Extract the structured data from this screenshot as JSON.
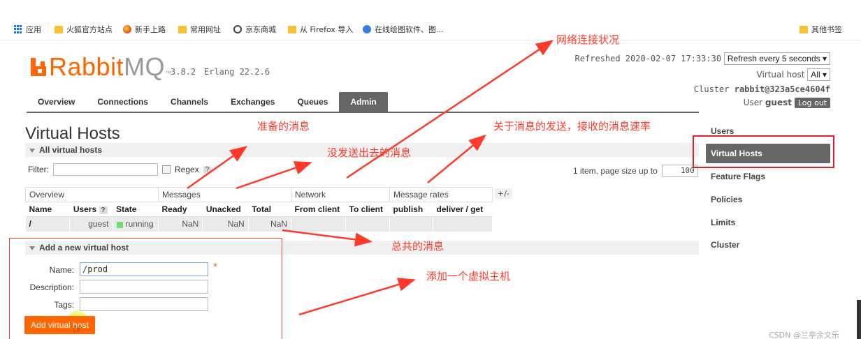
{
  "bookmarks": [
    {
      "label": "应用",
      "icon": "apps-grid-icon"
    },
    {
      "label": "火狐官方站点",
      "icon": "folder-icon"
    },
    {
      "label": "新手上路",
      "icon": "firefox-icon"
    },
    {
      "label": "常用网址",
      "icon": "folder-icon"
    },
    {
      "label": "京东商城",
      "icon": "globe-icon"
    },
    {
      "label": "从 Firefox 导入",
      "icon": "folder-icon"
    },
    {
      "label": "在线绘图软件、图...",
      "icon": "globe-icon"
    },
    {
      "label": "其他书签",
      "icon": "folder-icon"
    }
  ],
  "header": {
    "logo_rabbit": "Rabbit",
    "logo_mq": "MQ",
    "logo_tm": "™",
    "version": "3.8.2",
    "erlang": "Erlang 22.2.6",
    "refreshed_label": "Refreshed 2020-02-07 17:33:30",
    "refresh_select": "Refresh every 5 seconds",
    "virtual_host_label": "Virtual host",
    "virtual_host_value": "All",
    "cluster_label": "Cluster",
    "cluster_value": "rabbit@323a5ce4604f",
    "user_label": "User",
    "user_value": "guest",
    "logout_label": "Log out"
  },
  "tabs": [
    {
      "label": "Overview"
    },
    {
      "label": "Connections"
    },
    {
      "label": "Channels"
    },
    {
      "label": "Exchanges"
    },
    {
      "label": "Queues"
    },
    {
      "label": "Admin",
      "active": true
    }
  ],
  "main": {
    "title": "Virtual Hosts",
    "all_section": "All virtual hosts",
    "filter_label": "Filter:",
    "filter_value": "",
    "regex_label": "Regex",
    "help_mark": "?",
    "page_size_label": "1 item, page size up to",
    "page_size_value": "100",
    "plus_minus": "+/-",
    "group_headers": [
      "Overview",
      "Messages",
      "Network",
      "Message rates"
    ],
    "columns": [
      "Name",
      "Users",
      "State",
      "Ready",
      "Unacked",
      "Total",
      "From client",
      "To client",
      "publish",
      "deliver / get"
    ],
    "rows": [
      {
        "name": "/",
        "users": "guest",
        "state": "running",
        "ready": "NaN",
        "unacked": "NaN",
        "total": "NaN",
        "from_client": "",
        "to_client": "",
        "publish": "",
        "deliver_get": ""
      }
    ],
    "add_section": "Add a new virtual host",
    "form": {
      "name_label": "Name:",
      "name_value": "/prod",
      "desc_label": "Description:",
      "desc_value": "",
      "tags_label": "Tags:",
      "tags_value": "",
      "required_mark": "*",
      "submit_label": "Add virtual host"
    }
  },
  "sidebar": {
    "items": [
      "Users",
      "Virtual Hosts",
      "Feature Flags",
      "Policies",
      "Limits",
      "Cluster"
    ],
    "active": "Virtual Hosts"
  },
  "annotations": {
    "network_status": "网络连接状况",
    "ready": "准备的消息",
    "unacked": "没发送出去的消息",
    "rates": "关于消息的发送，接收的消息速率",
    "total": "总共的消息",
    "add_host": "添加一个虚拟主机"
  },
  "colors": {
    "brand": "#ff6600",
    "annotation": "#ff3a2a",
    "tab_active": "#666666"
  },
  "watermark": "CSDN @兰亭余文乐"
}
